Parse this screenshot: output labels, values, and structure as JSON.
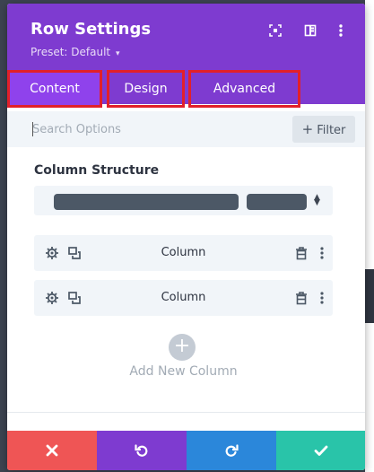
{
  "header": {
    "title": "Row Settings",
    "preset": "Preset: Default",
    "preset_caret": "▾"
  },
  "tabs": [
    {
      "label": "Content",
      "active": true
    },
    {
      "label": "Design",
      "active": false
    },
    {
      "label": "Advanced",
      "active": false
    }
  ],
  "search": {
    "placeholder": "Search Options",
    "filter_label": "Filter",
    "filter_plus": "+"
  },
  "column_structure": {
    "title": "Column Structure"
  },
  "columns": [
    {
      "label": "Column"
    },
    {
      "label": "Column"
    }
  ],
  "add_column": {
    "plus": "+",
    "label": "Add New Column"
  },
  "footer": {
    "buttons": [
      {
        "name": "discard",
        "color": "#ef5555",
        "icon": "close-icon"
      },
      {
        "name": "undo",
        "color": "#7e3bd0",
        "icon": "undo-icon"
      },
      {
        "name": "redo",
        "color": "#2b87da",
        "icon": "redo-icon"
      },
      {
        "name": "save",
        "color": "#29c4a9",
        "icon": "check-icon"
      }
    ]
  },
  "colors": {
    "header": "#7e3bd0",
    "active_tab": "#8f42ec",
    "highlight": "#e2202a"
  }
}
